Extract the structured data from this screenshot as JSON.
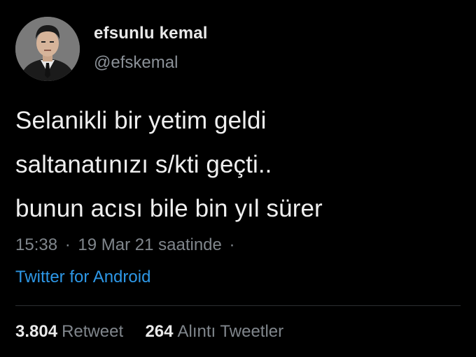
{
  "user": {
    "display_name": "efsunlu kemal",
    "handle": "@efskemal"
  },
  "tweet": {
    "lines": [
      "Selanikli bir yetim geldi",
      "saltanatınızı s/kti geçti..",
      "bunun acısı bile bin yıl sürer"
    ],
    "time": "15:38",
    "date": "19 Mar 21 saatinde",
    "separator": "·",
    "source": "Twitter for Android"
  },
  "stats": {
    "retweets": "3.804",
    "retweets_label": "Retweet",
    "quotes": "264",
    "quotes_label": "Alıntı Tweetler"
  },
  "colors": {
    "background": "#000000",
    "link": "#2d97e6",
    "muted": "#80868c"
  }
}
